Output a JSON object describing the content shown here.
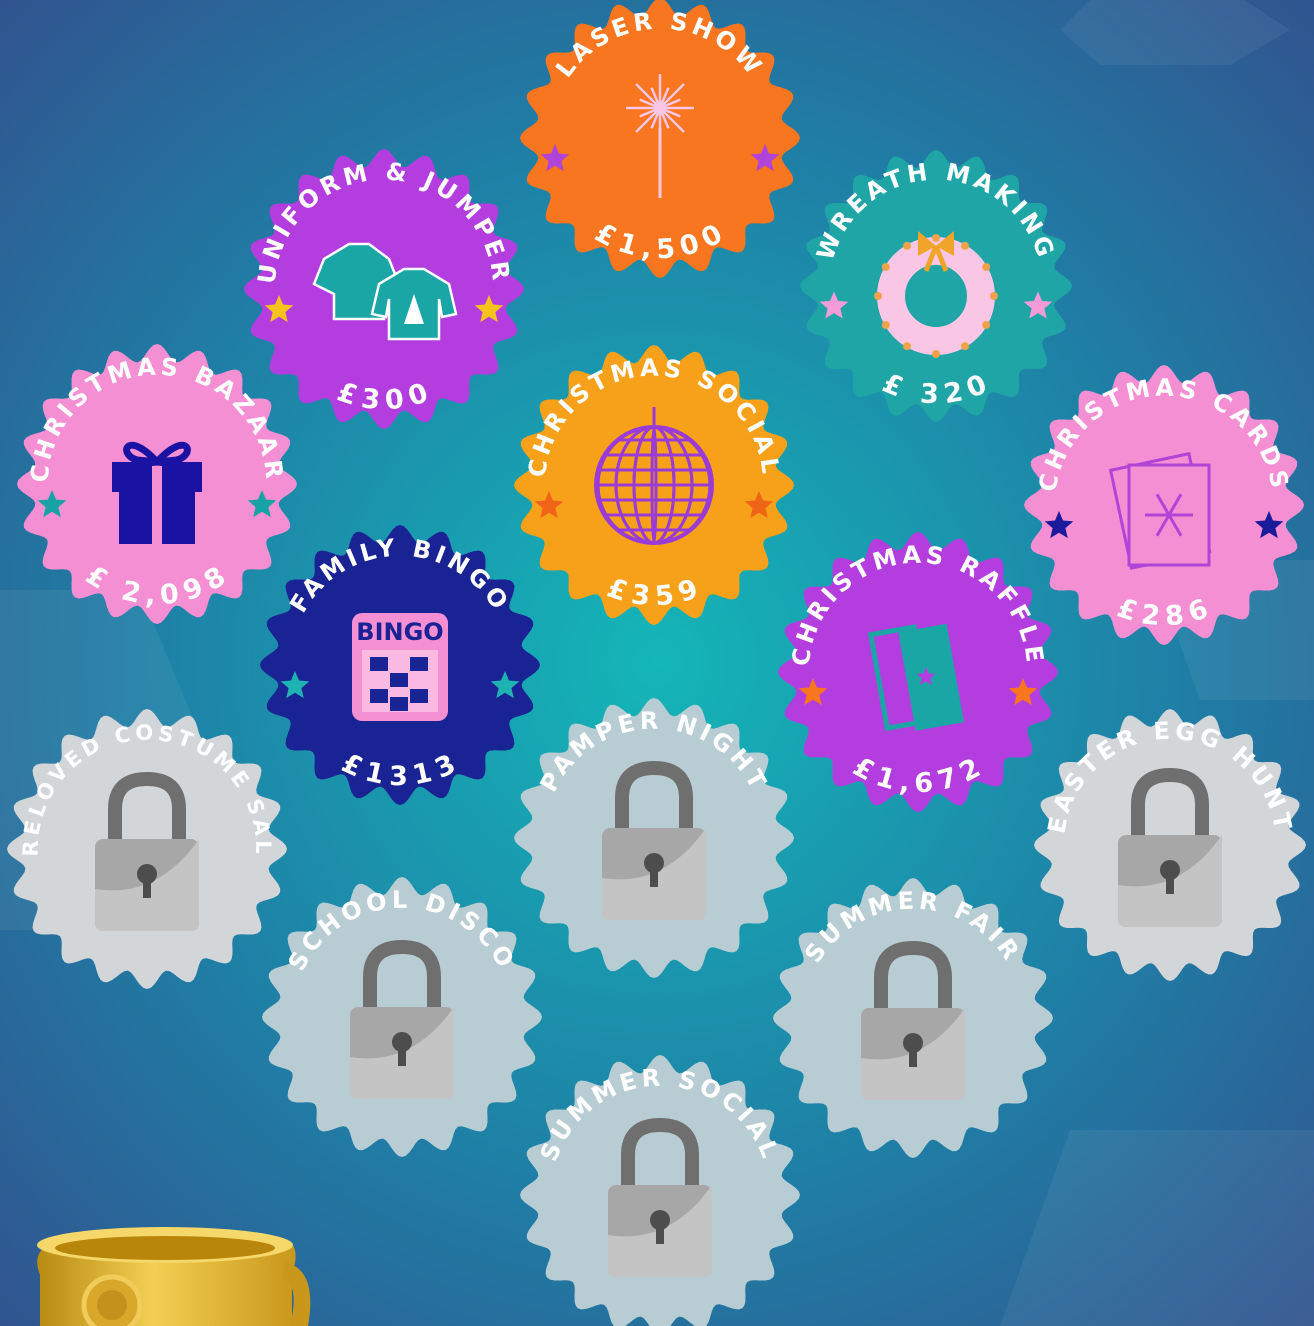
{
  "colors": {
    "bg_top": "#2f4f88",
    "bg_center": "#13b3b8",
    "bg_bottom": "#2d5b93",
    "orange": "#f7761f",
    "purple": "#b43de0",
    "teal": "#1fa5a6",
    "pink": "#f58fd4",
    "amber": "#f7a11a",
    "navy": "#1a2394",
    "locked_light": "#d2d6d8",
    "locked_blue": "#b8cdd3"
  },
  "badges": [
    {
      "title": "LASER SHOW",
      "price": "£1,500",
      "status": "unlocked",
      "color": "orange",
      "icon": "sparkler-icon",
      "star_color": "#b043d8"
    },
    {
      "title": "UNIFORM & JUMPER",
      "price": "£300",
      "status": "unlocked",
      "color": "purple",
      "icon": "jumper-icon",
      "star_color": "#f6c21c"
    },
    {
      "title": "WREATH MAKING",
      "price": "£ 320",
      "status": "unlocked",
      "color": "teal",
      "icon": "wreath-icon",
      "star_color": "#f59bd9"
    },
    {
      "title": "CHRISTMAS BAZAAR",
      "price": "£ 2,098",
      "status": "unlocked",
      "color": "pink",
      "icon": "gift-icon",
      "star_color": "#17a3a6"
    },
    {
      "title": "CHRISTMAS SOCIAL",
      "price": "£359",
      "status": "unlocked",
      "color": "amber",
      "icon": "disco-ball-icon",
      "star_color": "#f06418"
    },
    {
      "title": "CHRISTMAS CARDS",
      "price": "£286",
      "status": "unlocked",
      "color": "pink",
      "icon": "card-icon",
      "star_color": "#1a1a9a"
    },
    {
      "title": "FAMILY BINGO",
      "price": "£1313",
      "status": "unlocked",
      "color": "navy",
      "icon": "bingo-icon",
      "star_color": "#1fb2b2",
      "icon_text": "BINGO"
    },
    {
      "title": "CHRISTMAS RAFFLE",
      "price": "£1,672",
      "status": "unlocked",
      "color": "purple",
      "icon": "raffle-ticket-icon",
      "star_color": "#f7761f"
    },
    {
      "title": "PRELOVED COSTUME SALE",
      "price": "",
      "status": "locked",
      "color": "locked_light",
      "icon": "padlock-icon"
    },
    {
      "title": "PAMPER NIGHT",
      "price": "",
      "status": "locked",
      "color": "locked_blue",
      "icon": "padlock-icon"
    },
    {
      "title": "EASTER EGG HUNT",
      "price": "",
      "status": "locked",
      "color": "locked_light",
      "icon": "padlock-icon"
    },
    {
      "title": "SCHOOL DISCO",
      "price": "",
      "status": "locked",
      "color": "locked_blue",
      "icon": "padlock-icon"
    },
    {
      "title": "SUMMER FAIR",
      "price": "",
      "status": "locked",
      "color": "locked_blue",
      "icon": "padlock-icon"
    },
    {
      "title": "SUMMER SOCIAL",
      "price": "",
      "status": "locked",
      "color": "locked_blue",
      "icon": "padlock-icon"
    }
  ],
  "trophy": {
    "icon": "trophy-icon",
    "color": "#e2b52a"
  }
}
